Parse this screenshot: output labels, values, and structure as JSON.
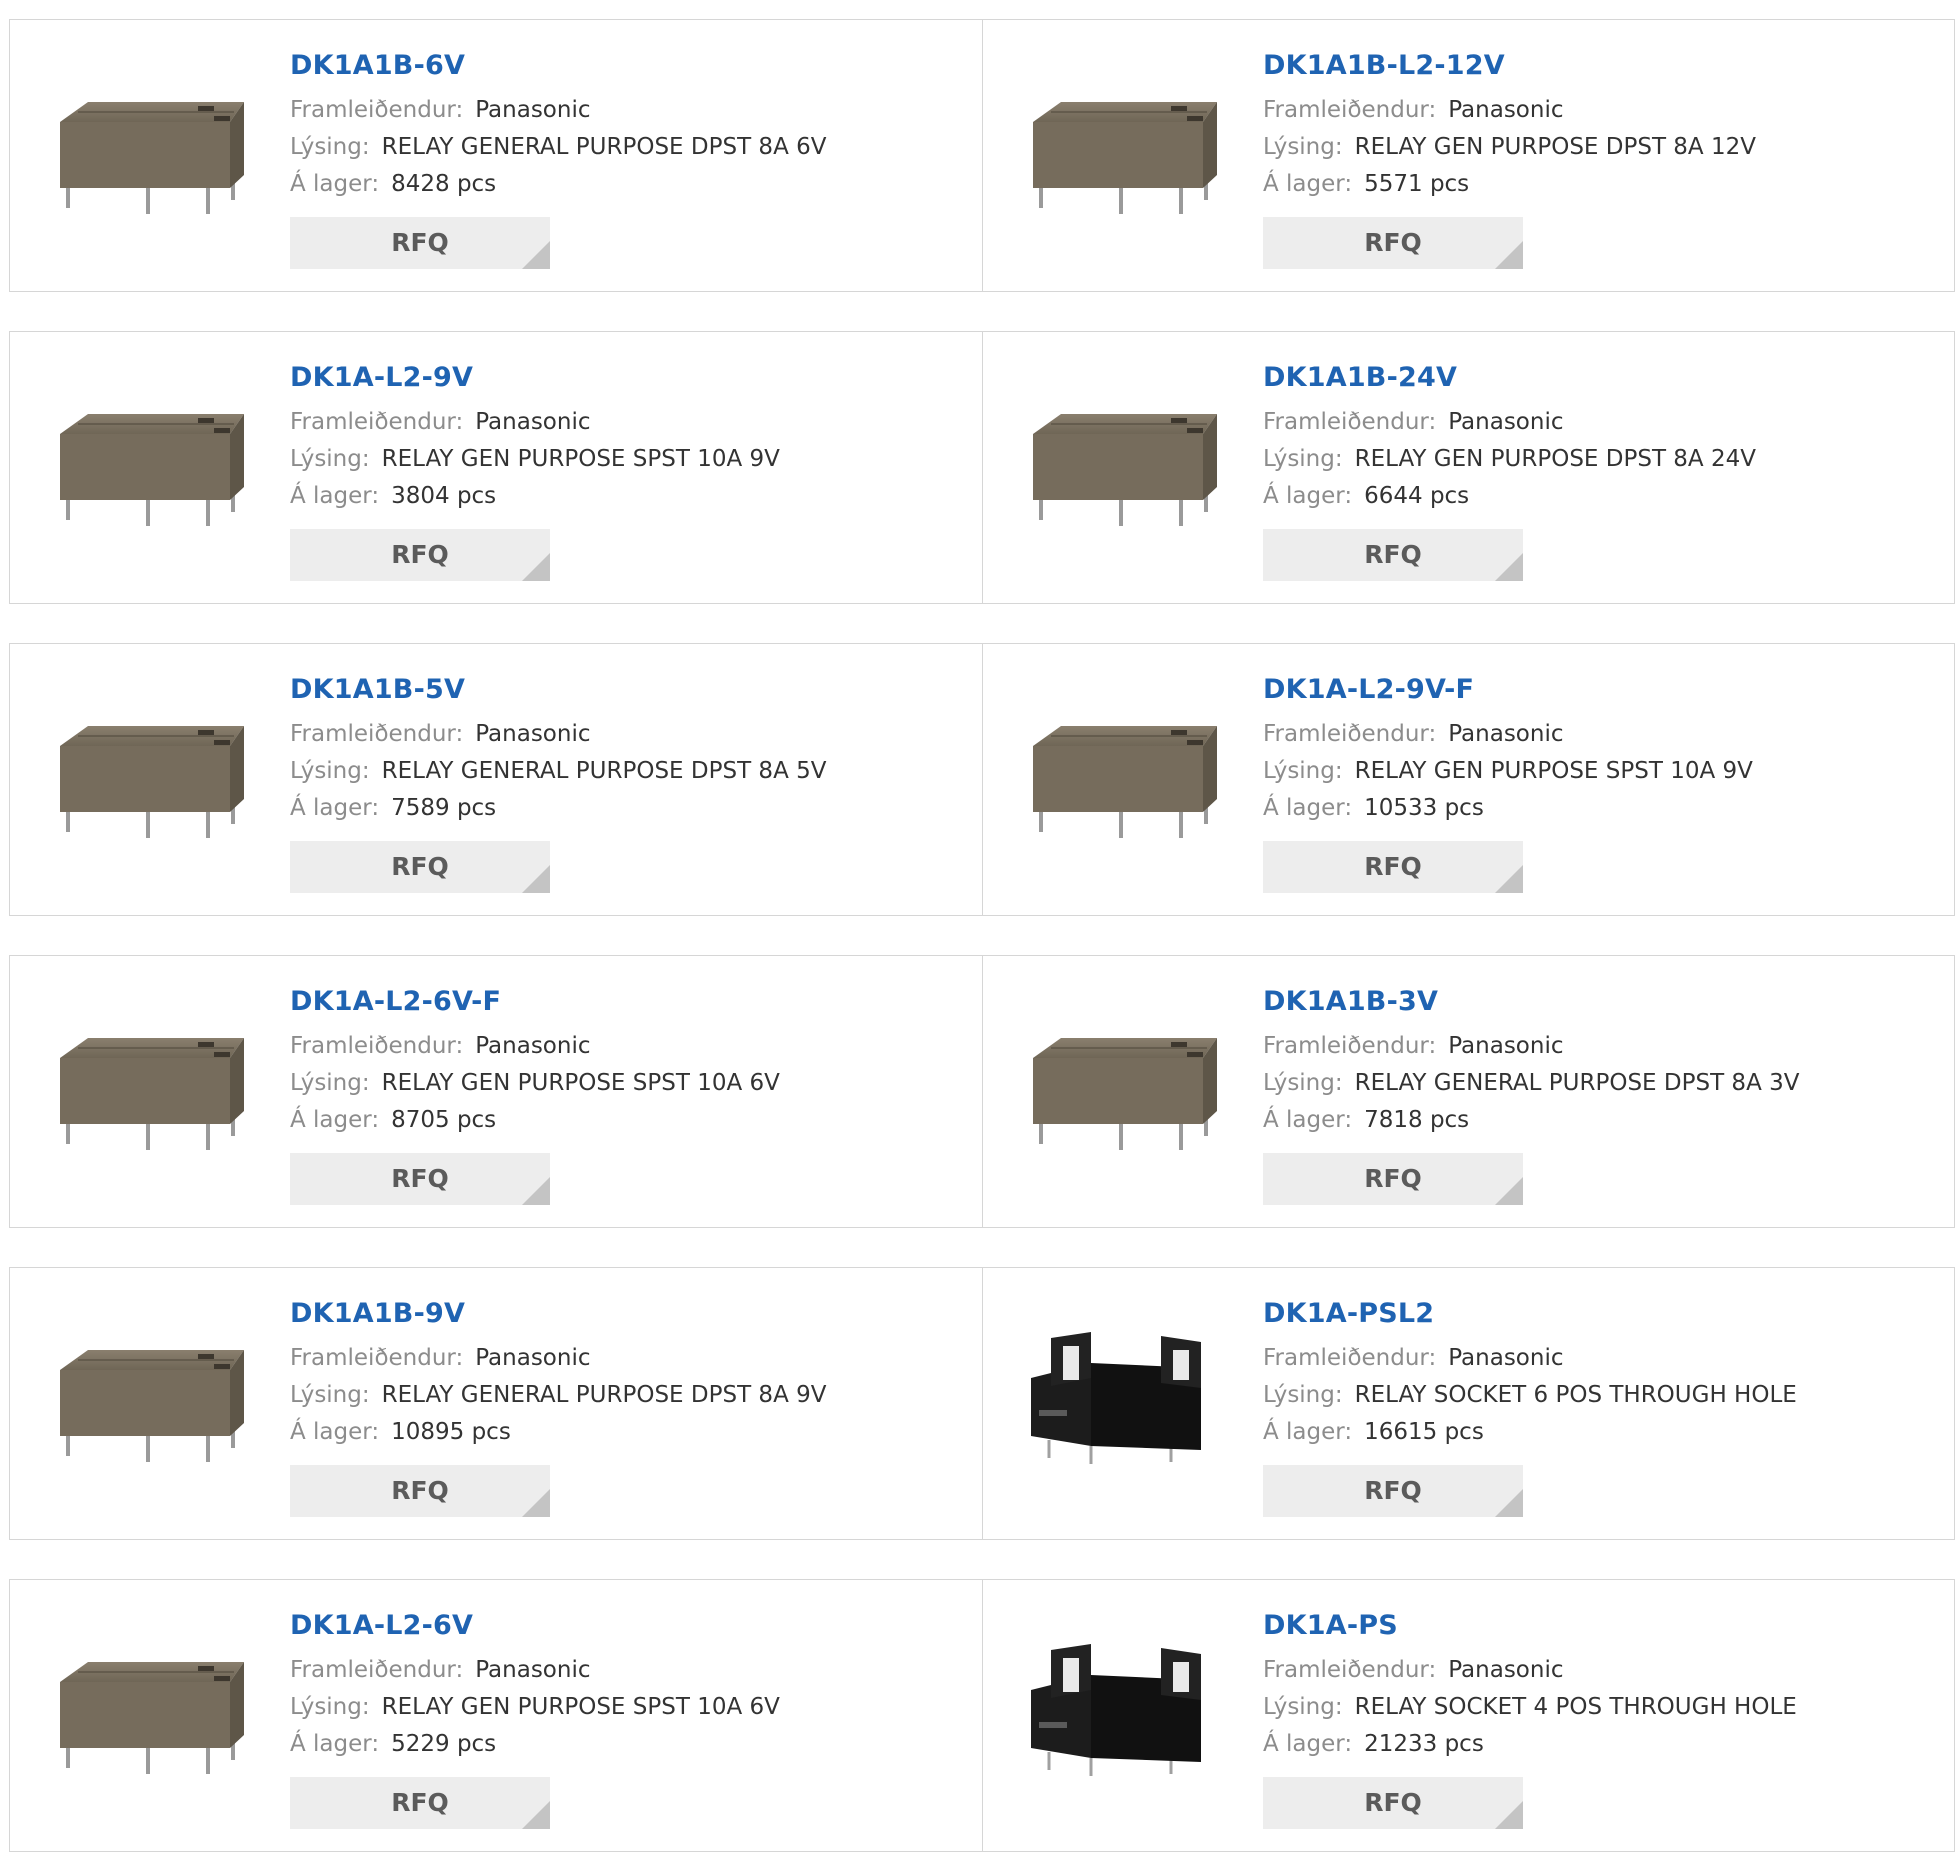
{
  "labels": {
    "manufacturer": "Framleiðendur:",
    "description": "Lýsing:",
    "stock": "Á lager:",
    "rfq": "RFQ"
  },
  "colors": {
    "part_link": "#1f63b2",
    "border": "#d6d6d6",
    "rfq_bg": "#ededed"
  },
  "rows": [
    [
      {
        "part": "DK1A1B-6V",
        "manufacturer": "Panasonic",
        "description": "RELAY GENERAL PURPOSE DPST 8A 6V",
        "stock": "8428 pcs",
        "image": "relay-icon"
      },
      {
        "part": "DK1A1B-L2-12V",
        "manufacturer": "Panasonic",
        "description": "RELAY GEN PURPOSE DPST 8A 12V",
        "stock": "5571 pcs",
        "image": "relay-icon"
      }
    ],
    [
      {
        "part": "DK1A-L2-9V",
        "manufacturer": "Panasonic",
        "description": "RELAY GEN PURPOSE SPST 10A 9V",
        "stock": "3804 pcs",
        "image": "relay-icon"
      },
      {
        "part": "DK1A1B-24V",
        "manufacturer": "Panasonic",
        "description": "RELAY GEN PURPOSE DPST 8A 24V",
        "stock": "6644 pcs",
        "image": "relay-icon"
      }
    ],
    [
      {
        "part": "DK1A1B-5V",
        "manufacturer": "Panasonic",
        "description": "RELAY GENERAL PURPOSE DPST 8A 5V",
        "stock": "7589 pcs",
        "image": "relay-icon"
      },
      {
        "part": "DK1A-L2-9V-F",
        "manufacturer": "Panasonic",
        "description": "RELAY GEN PURPOSE SPST 10A 9V",
        "stock": "10533 pcs",
        "image": "relay-icon"
      }
    ],
    [
      {
        "part": "DK1A-L2-6V-F",
        "manufacturer": "Panasonic",
        "description": "RELAY GEN PURPOSE SPST 10A 6V",
        "stock": "8705 pcs",
        "image": "relay-icon"
      },
      {
        "part": "DK1A1B-3V",
        "manufacturer": "Panasonic",
        "description": "RELAY GENERAL PURPOSE DPST 8A 3V",
        "stock": "7818 pcs",
        "image": "relay-icon"
      }
    ],
    [
      {
        "part": "DK1A1B-9V",
        "manufacturer": "Panasonic",
        "description": "RELAY GENERAL PURPOSE DPST 8A 9V",
        "stock": "10895 pcs",
        "image": "relay-icon"
      },
      {
        "part": "DK1A-PSL2",
        "manufacturer": "Panasonic",
        "description": "RELAY SOCKET 6 POS THROUGH HOLE",
        "stock": "16615 pcs",
        "image": "socket-icon"
      }
    ],
    [
      {
        "part": "DK1A-L2-6V",
        "manufacturer": "Panasonic",
        "description": "RELAY GEN PURPOSE SPST 10A 6V",
        "stock": "5229 pcs",
        "image": "relay-icon"
      },
      {
        "part": "DK1A-PS",
        "manufacturer": "Panasonic",
        "description": "RELAY SOCKET 4 POS THROUGH HOLE",
        "stock": "21233 pcs",
        "image": "socket-icon"
      }
    ]
  ]
}
